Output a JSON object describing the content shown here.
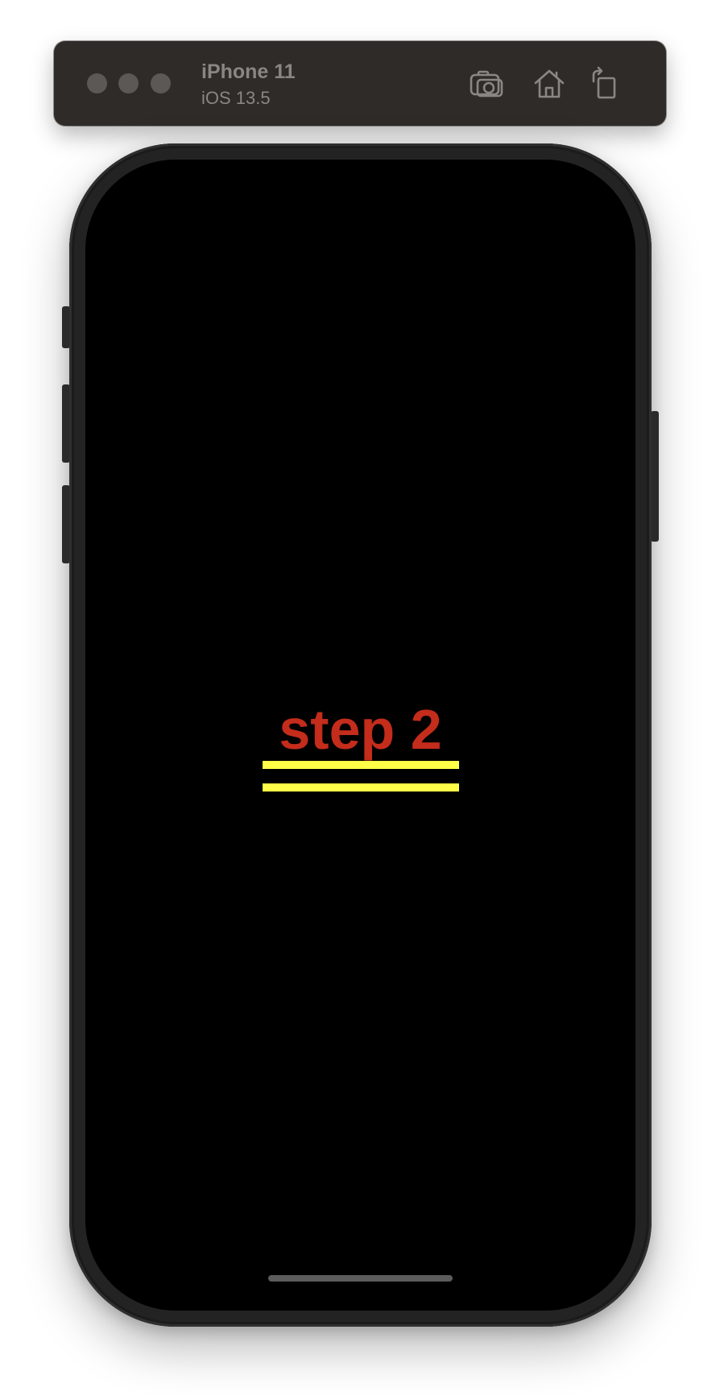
{
  "simulator": {
    "device_name": "iPhone 11",
    "os_version": "iOS 13.5",
    "toolbar": {
      "screenshot_icon": "camera-icon",
      "home_icon": "home-icon",
      "rotate_icon": "rotate-icon"
    }
  },
  "app": {
    "title": "step 2",
    "title_color": "#c42c1b",
    "underline_color": "#ffff47",
    "background_color": "#000000"
  }
}
